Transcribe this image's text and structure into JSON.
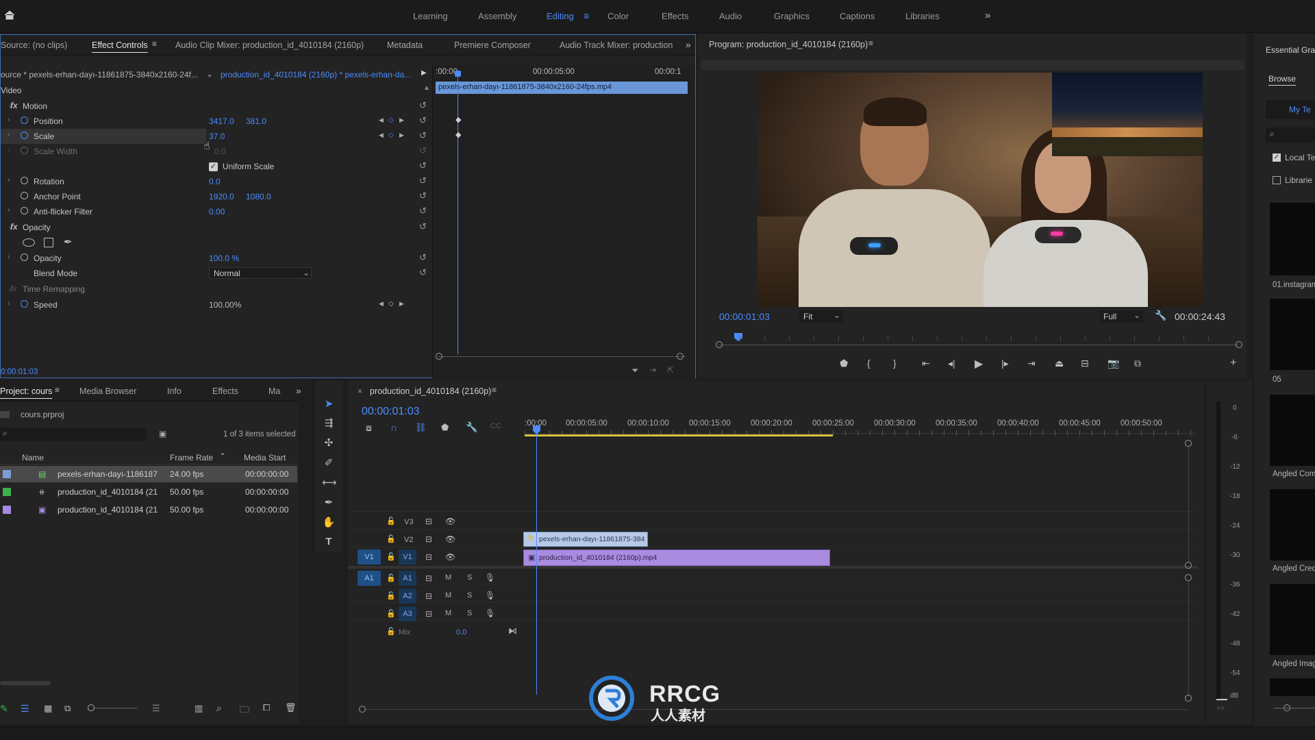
{
  "workspaces": {
    "tabs": [
      "Learning",
      "Assembly",
      "Editing",
      "Color",
      "Effects",
      "Audio",
      "Graphics",
      "Captions",
      "Libraries"
    ],
    "active": "Editing",
    "more": "»"
  },
  "source_panel": {
    "tabs": [
      "Source: (no clips)",
      "Effect Controls",
      "Audio Clip Mixer: production_id_4010184 (2160p)",
      "Metadata",
      "Premiere Composer",
      "Audio Track Mixer: production"
    ],
    "active": "Effect Controls",
    "source_clip": "ource * pexels-erhan-dayı-11861875-3840x2160-24f...",
    "sequence_clip": "production_id_4010184 (2160p) * pexels-erhan-da...",
    "section_video": "Video",
    "timecode_left": ":00:00",
    "timecode_mid": "00:00:05:00",
    "timecode_right": "00:00:1",
    "mini_clip_name": "pexels-erhan-dayı-11861875-3840x2160-24fps.mp4",
    "current_time": "0:00:01:03",
    "rows": {
      "motion": "Motion",
      "position": {
        "label": "Position",
        "x": "3417.0",
        "y": "381.0"
      },
      "scale": {
        "label": "Scale",
        "value": "37.0"
      },
      "scale_width": {
        "label": "Scale Width",
        "value": "0.0"
      },
      "uniform_scale": "Uniform Scale",
      "rotation": {
        "label": "Rotation",
        "value": "0.0"
      },
      "anchor_point": {
        "label": "Anchor Point",
        "x": "1920.0",
        "y": "1080.0"
      },
      "anti_flicker": {
        "label": "Anti-flicker Filter",
        "value": "0.00"
      },
      "opacity_group": "Opacity",
      "opacity": {
        "label": "Opacity",
        "value": "100.0 %"
      },
      "blend_mode": {
        "label": "Blend Mode",
        "value": "Normal"
      },
      "time_remapping": "Time Remapping",
      "speed": {
        "label": "Speed",
        "value": "100.00%"
      }
    }
  },
  "program_monitor": {
    "title": "Program: production_id_4010184 (2160p)",
    "timecode": "00:00:01:03",
    "fit": "Fit",
    "quality": "Full",
    "duration": "00:00:24:43"
  },
  "project_panel": {
    "tabs": [
      "Project: cours",
      "Media Browser",
      "Info",
      "Effects",
      "Ma"
    ],
    "file": "cours.prproj",
    "selection_info": "1 of 3 items selected",
    "columns": [
      "Name",
      "Frame Rate",
      "Media Start"
    ],
    "items": [
      {
        "name": "pexels-erhan-dayı-1186187",
        "fps": "24.00 fps",
        "start": "00:00:00:00",
        "color": "#7a9bd6"
      },
      {
        "name": "production_id_4010184 (21",
        "fps": "50.00 fps",
        "start": "00:00:00:00",
        "color": "#3bb24a"
      },
      {
        "name": "production_id_4010184 (21",
        "fps": "50.00 fps",
        "start": "00:00:00:00",
        "color": "#a78be0"
      }
    ]
  },
  "timeline": {
    "tab": "production_id_4010184 (2160p)",
    "timecode": "00:00:01:03",
    "ruler": [
      ":00:00",
      "00:00:05:00",
      "00:00:10:00",
      "00:00:15:00",
      "00:00:20:00",
      "00:00:25:00",
      "00:00:30:00",
      "00:00:35:00",
      "00:00:40:00",
      "00:00:45:00",
      "00:00:50:00"
    ],
    "video_tracks": [
      "V3",
      "V2",
      "V1"
    ],
    "audio_tracks": [
      "A1",
      "A2",
      "A3"
    ],
    "source_v": "V1",
    "source_a": "A1",
    "mix_label": "Mix",
    "mix_value": "0.0",
    "mute": "M",
    "solo": "S",
    "clips": {
      "v2": "pexels-erhan-dayı-11861875-384",
      "v1": "production_id_4010184 (2160p).mp4"
    }
  },
  "meter": {
    "scale": [
      "0",
      "-6",
      "-12",
      "-18",
      "-24",
      "-30",
      "-36",
      "-42",
      "-48",
      "-54",
      "dB"
    ]
  },
  "essential_graphics": {
    "title": "Essential Gra",
    "tab": "Browse",
    "my_templates": "My Te",
    "checks": [
      "Local Te",
      "Librarie"
    ],
    "items": [
      "01.instagram",
      "05",
      "Angled Com",
      "Angled Cred",
      "Angled Imag"
    ]
  },
  "watermark": {
    "brand": "RRCG",
    "sub": "人人素材"
  }
}
